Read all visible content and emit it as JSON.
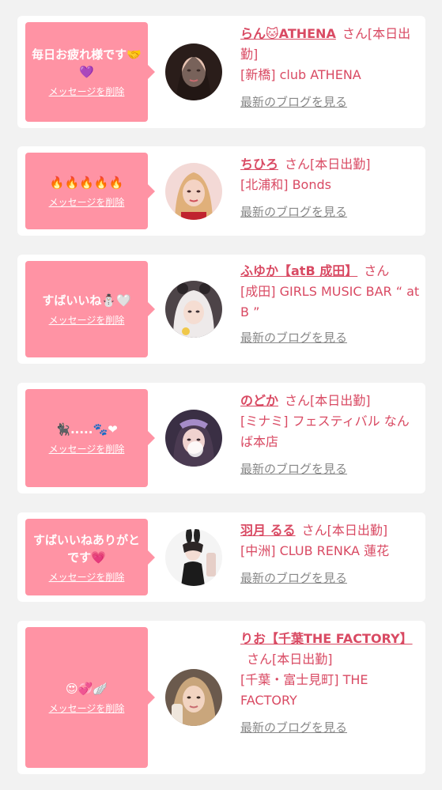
{
  "delete_label": "メッセージを削除",
  "blog_label": "最新のブログを見る",
  "colors": {
    "bubble": "#ff93a4",
    "accent_text": "#d94a63",
    "link_gray": "#888888",
    "background": "#f2f2f2"
  },
  "messages": [
    {
      "bubble_text": "毎日お疲れ様です🤝💜",
      "name": "らん🐱ATHENA",
      "san": "さん[本日出勤]",
      "shop": "[新橋] club ATHENA",
      "avatar": "avatar-dark-hair-woman"
    },
    {
      "bubble_text": "🔥🔥🔥🔥🔥",
      "name": "ちひろ",
      "san": "さん[本日出勤]",
      "shop": "[北浦和] Bonds",
      "avatar": "avatar-blonde-woman"
    },
    {
      "bubble_text": "すばいいね⛄🤍",
      "name": "ふゆか【atB 成田】",
      "san": "さん",
      "shop": "[成田] GIRLS MUSIC BAR “ at B ”",
      "avatar": "avatar-white-hair-woman"
    },
    {
      "bubble_text": "🐈‍⬛.....🐾❤",
      "name": "のどか",
      "san": "さん[本日出勤]",
      "shop": "[ミナミ] フェスティバル なんば本店",
      "avatar": "avatar-maid-woman"
    },
    {
      "bubble_text": "すばいいねありがとです💗",
      "name": "羽月 るる",
      "san": "さん[本日出勤]",
      "shop": "[中洲] CLUB RENKA 蓮花",
      "avatar": "avatar-bunny-woman"
    },
    {
      "bubble_text": "😍💞🪽",
      "name": "りお【千葉THE FACTORY】",
      "san": "さん[本日出勤]",
      "shop": "[千葉・富士見町] THE FACTORY",
      "avatar": "avatar-blonde-selfie-woman"
    }
  ]
}
